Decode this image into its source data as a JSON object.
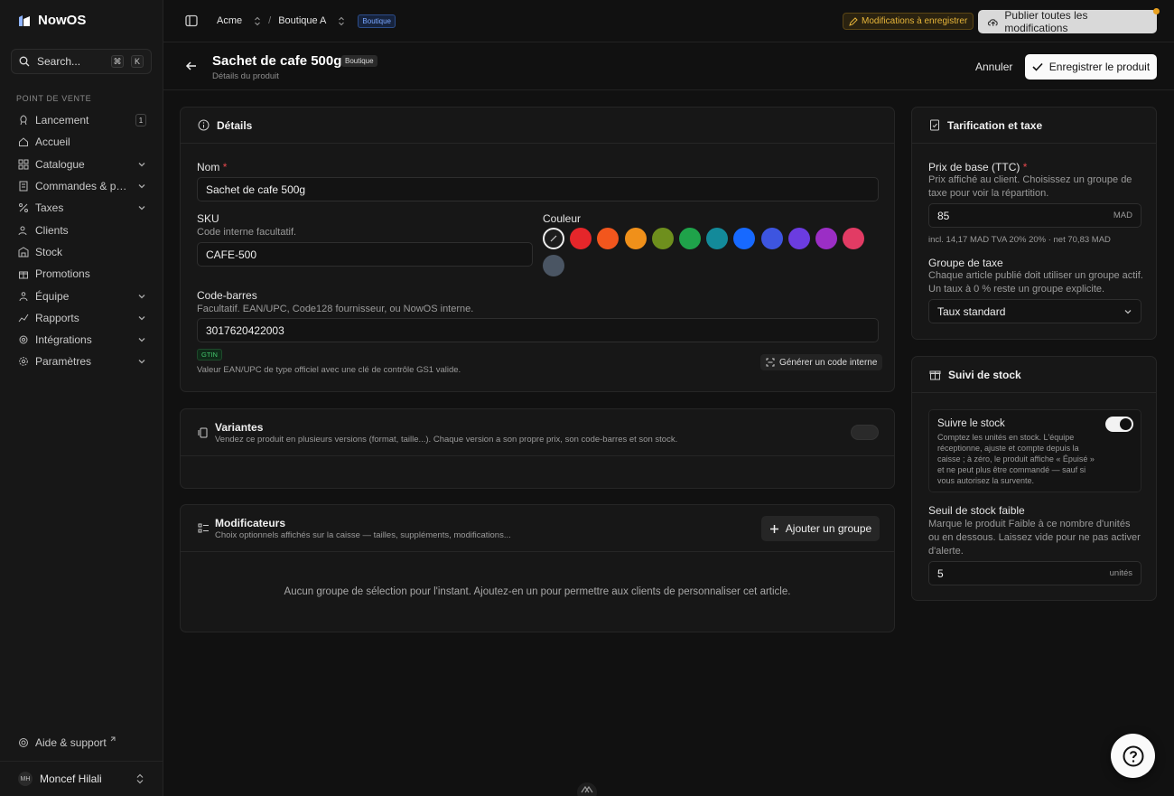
{
  "app": {
    "name": "NowOS"
  },
  "search": {
    "label": "Search...",
    "kbd1": "⌘",
    "kbd2": "K"
  },
  "sidebar": {
    "section": "POINT DE VENTE",
    "items": [
      {
        "label": "Lancement",
        "badge": "1"
      },
      {
        "label": "Accueil"
      },
      {
        "label": "Catalogue"
      },
      {
        "label": "Commandes & pai..."
      },
      {
        "label": "Taxes"
      },
      {
        "label": "Clients"
      },
      {
        "label": "Stock"
      },
      {
        "label": "Promotions"
      },
      {
        "label": "Équipe"
      },
      {
        "label": "Rapports"
      },
      {
        "label": "Intégrations"
      },
      {
        "label": "Paramètres"
      }
    ],
    "help": "Aide & support",
    "user": {
      "initials": "MH",
      "name": "Moncef Hilali"
    }
  },
  "topbar": {
    "org": "Acme",
    "sep": "/",
    "shop": "Boutique A",
    "shop_badge": "Boutique",
    "pending": "Modifications à enregistrer",
    "publish": "Publier toutes les modifications"
  },
  "page": {
    "title": "Sachet de cafe 500g",
    "badge": "Boutique",
    "subtitle": "Détails du produit",
    "cancel": "Annuler",
    "save": "Enregistrer le produit"
  },
  "details": {
    "heading": "Détails",
    "name_label": "Nom",
    "name_value": "Sachet de cafe 500g",
    "sku_label": "SKU",
    "sku_help": "Code interne facultatif.",
    "sku_value": "CAFE-500",
    "color_label": "Couleur",
    "colors": [
      "#e5262a",
      "#f2561d",
      "#f0901a",
      "#6e8f1d",
      "#1fa34a",
      "#138a9a",
      "#1769ff",
      "#3d55e0",
      "#6b3ce0",
      "#9b2ec5",
      "#e23b64",
      "#4a5563"
    ],
    "barcode_label": "Code-barres",
    "barcode_help": "Facultatif. EAN/UPC, Code128 fournisseur, ou NowOS interne.",
    "barcode_value": "3017620422003",
    "gtin": "GTIN",
    "gtin_help": "Valeur EAN/UPC de type officiel avec une clé de contrôle GS1 valide.",
    "generate": "Générer un code interne"
  },
  "variants": {
    "heading": "Variantes",
    "desc": "Vendez ce produit en plusieurs versions (format, taille...). Chaque version a son propre prix, son code-barres et son stock.",
    "enabled": false
  },
  "modifiers": {
    "heading": "Modificateurs",
    "desc": "Choix optionnels affichés sur la caisse — tailles, suppléments, modifications...",
    "add": "Ajouter un groupe",
    "empty": "Aucun groupe de sélection pour l'instant. Ajoutez-en un pour permettre aux clients de personnaliser cet article."
  },
  "pricing": {
    "heading": "Tarification et taxe",
    "price_label": "Prix de base (TTC)",
    "price_help": "Prix affiché au client. Choisissez un groupe de taxe pour voir la répartition.",
    "price_value": "85",
    "currency": "MAD",
    "breakdown": "incl. 14,17 MAD TVA 20% 20% · net 70,83 MAD",
    "tax_label": "Groupe de taxe",
    "tax_help": "Chaque article publié doit utiliser un groupe actif. Un taux à 0 % reste un groupe explicite.",
    "tax_value": "Taux standard"
  },
  "stock": {
    "heading": "Suivi de stock",
    "track_label": "Suivre le stock",
    "track_help": "Comptez les unités en stock. L'équipe réceptionne, ajuste et compte depuis la caisse ; à zéro, le produit affiche « Épuisé » et ne peut plus être commandé — sauf si vous autorisez la survente.",
    "track_enabled": true,
    "low_label": "Seuil de stock faible",
    "low_help": "Marque le produit Faible à ce nombre d'unités ou en dessous. Laissez vide pour ne pas activer d'alerte.",
    "low_value": "5",
    "unit": "unités"
  }
}
